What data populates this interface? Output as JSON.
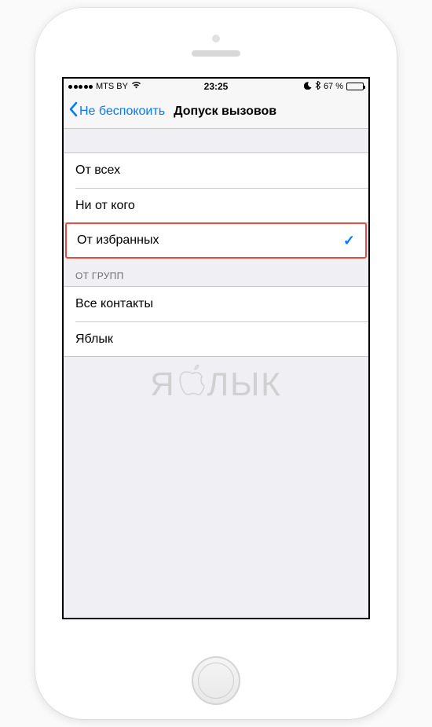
{
  "status": {
    "carrier": "MTS BY",
    "time": "23:25",
    "battery_pct": "67 %"
  },
  "nav": {
    "back_label": "Не беспокоить",
    "title": "Допуск вызовов"
  },
  "options": {
    "everyone": "От всех",
    "no_one": "Ни от кого",
    "favorites": "От избранных"
  },
  "groups": {
    "header": "ОТ ГРУПП",
    "all_contacts": "Все контакты",
    "yablyk": "Яблык"
  },
  "watermark": {
    "left": "Я",
    "right": "ЛЫК"
  }
}
